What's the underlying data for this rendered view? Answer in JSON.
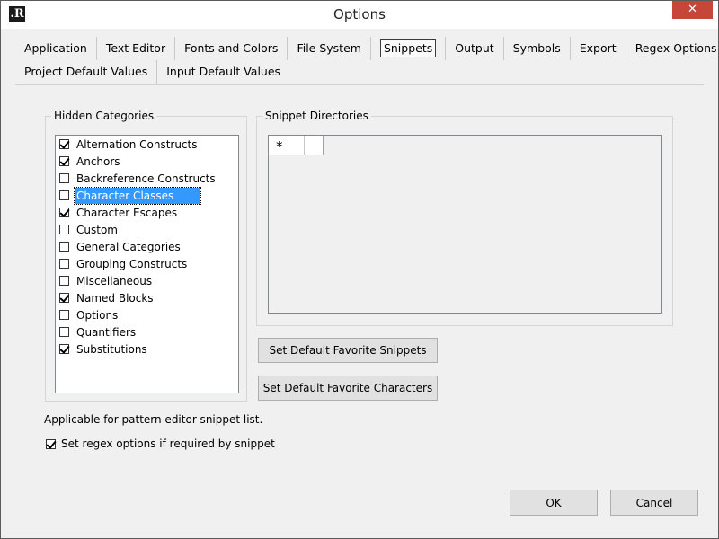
{
  "window": {
    "title": "Options",
    "app_icon_glyph": ".R",
    "close_glyph": "✕"
  },
  "tabs": {
    "row1": [
      "Application",
      "Text Editor",
      "Fonts and Colors",
      "File System",
      "Snippets",
      "Output",
      "Symbols",
      "Export",
      "Regex Options"
    ],
    "row2": [
      "Project Default Values",
      "Input Default Values"
    ],
    "active": "Snippets"
  },
  "hidden_categories": {
    "label": "Hidden Categories",
    "items": [
      {
        "label": "Alternation Constructs",
        "checked": true
      },
      {
        "label": "Anchors",
        "checked": true
      },
      {
        "label": "Backreference Constructs",
        "checked": false
      },
      {
        "label": "Character Classes",
        "checked": false,
        "selected": true
      },
      {
        "label": "Character Escapes",
        "checked": true
      },
      {
        "label": "Custom",
        "checked": false
      },
      {
        "label": "General Categories",
        "checked": false
      },
      {
        "label": "Grouping Constructs",
        "checked": false
      },
      {
        "label": "Miscellaneous",
        "checked": false
      },
      {
        "label": "Named Blocks",
        "checked": true
      },
      {
        "label": "Options",
        "checked": false
      },
      {
        "label": "Quantifiers",
        "checked": false
      },
      {
        "label": "Substitutions",
        "checked": true
      }
    ]
  },
  "snippet_directories": {
    "label": "Snippet Directories",
    "new_row_marker": "*"
  },
  "buttons": {
    "favorite_snippets": "Set Default Favorite Snippets",
    "favorite_characters": "Set Default Favorite Characters",
    "ok": "OK",
    "cancel": "Cancel"
  },
  "note": "Applicable for pattern editor snippet list.",
  "regex_options_checkbox": {
    "label": "Set regex options if required by snippet",
    "checked": true
  },
  "colors": {
    "selection": "#3399ff",
    "close_button": "#c7463b",
    "dialog_background": "#f0f0f0"
  }
}
